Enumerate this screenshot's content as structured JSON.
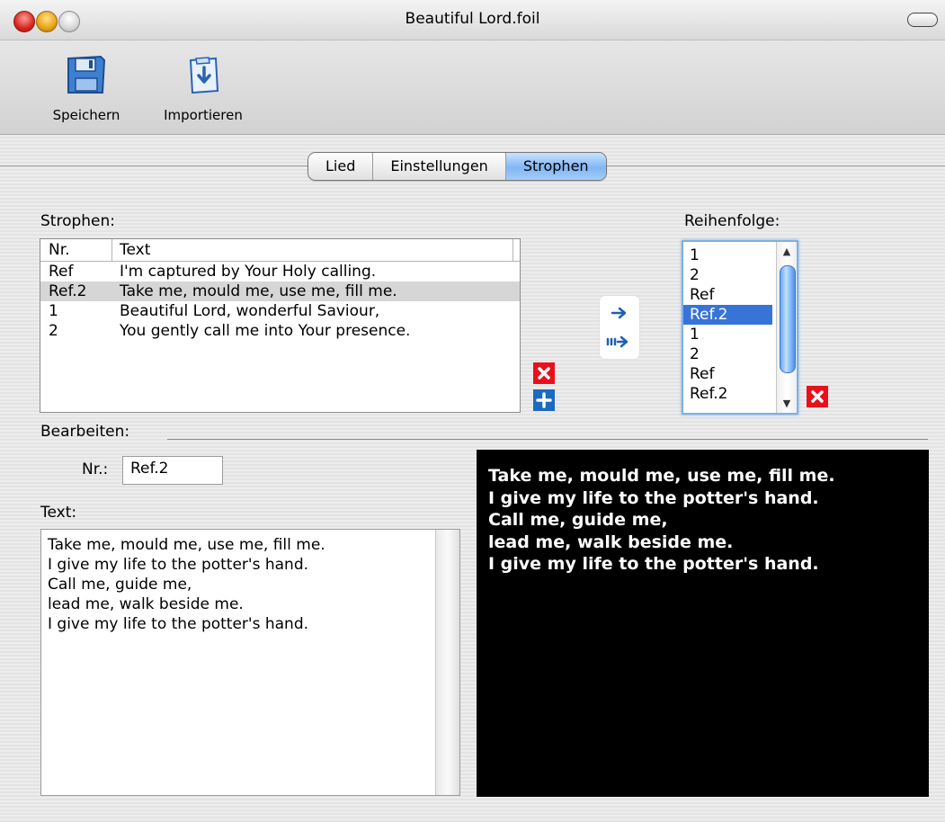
{
  "window": {
    "title": "Beautiful Lord.foil"
  },
  "toolbar": {
    "save_label": "Speichern",
    "import_label": "Importieren",
    "save_icon": "floppy-disk-icon",
    "import_icon": "import-clipboard-icon"
  },
  "tabs": [
    {
      "label": "Lied",
      "active": false
    },
    {
      "label": "Einstellungen",
      "active": false
    },
    {
      "label": "Strophen",
      "active": true
    }
  ],
  "strophen": {
    "label": "Strophen:",
    "columns": [
      "Nr.",
      "Text"
    ],
    "rows": [
      {
        "nr": "Ref",
        "text": "I'm captured by Your Holy calling."
      },
      {
        "nr": "Ref.2",
        "text": "Take me, mould me, use me, fill me."
      },
      {
        "nr": "1",
        "text": "Beautiful Lord, wonderful Saviour,"
      },
      {
        "nr": "2",
        "text": "You gently call me into Your presence."
      }
    ],
    "selected_index": 1
  },
  "reihenfolge": {
    "label": "Reihenfolge:",
    "items": [
      "1",
      "2",
      "Ref",
      "Ref.2",
      "1",
      "2",
      "Ref",
      "Ref.2"
    ],
    "selected_index": 3
  },
  "bearbeiten": {
    "label": "Bearbeiten:",
    "nr_label": "Nr.:",
    "nr_value": "Ref.2",
    "text_label": "Text:",
    "text_lines": [
      "Take me, mould me, use me, fill me.",
      "I give my life to the potter's hand.",
      "Call me, guide me,",
      "lead me, walk beside me.",
      "I give my life to the potter's hand."
    ]
  },
  "preview": {
    "lines": [
      "Take me, mould me, use me, fill me.",
      "I give my life to the potter's hand.",
      "Call me, guide me,",
      "lead me, walk beside me.",
      "I give my life to the potter's hand."
    ]
  },
  "colors": {
    "delete_red": "#e8101d",
    "add_blue": "#1b6bc0",
    "selection_blue": "#3874d8"
  }
}
